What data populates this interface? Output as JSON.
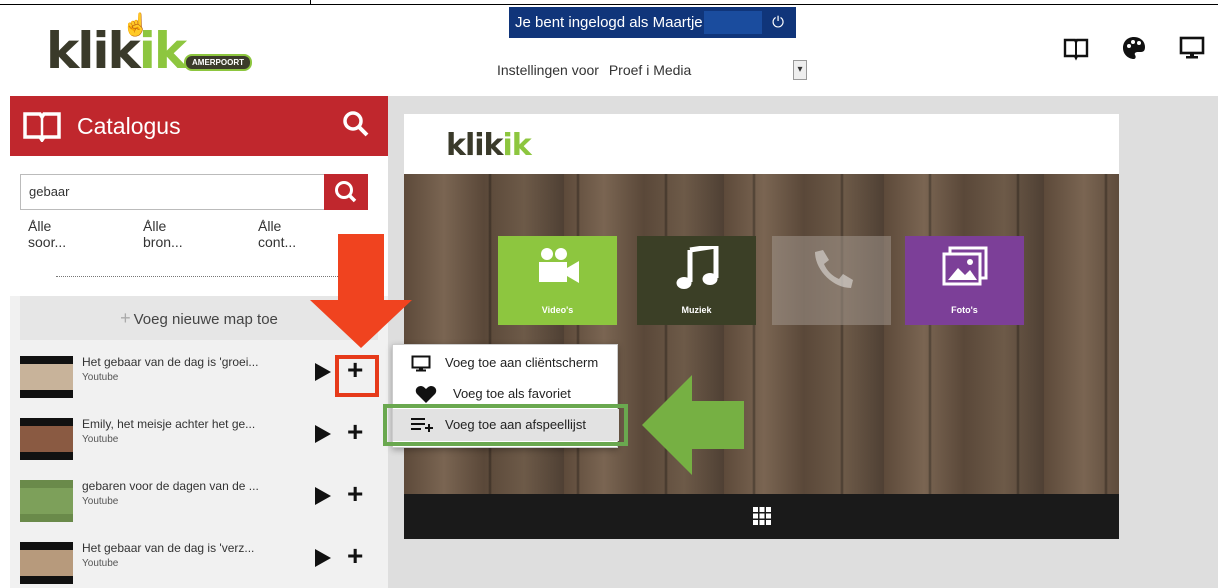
{
  "header": {
    "logo": {
      "main": "klik",
      "accent": "ik",
      "badge": "AMERPOORT"
    },
    "login_text": "Je bent ingelogd als Maartje",
    "settings_label": "Instellingen voor",
    "settings_value": "Proef i Media",
    "icons": [
      "book-icon",
      "palette-icon",
      "monitor-icon"
    ]
  },
  "catalog": {
    "title": "Catalogus",
    "search_value": "gebaar",
    "filters": [
      "Alle soor...",
      "Alle bron...",
      "Alle cont..."
    ],
    "new_folder": "Voeg nieuwe map toe",
    "items": [
      {
        "title": "Het gebaar van de dag is 'groei...",
        "source": "Youtube"
      },
      {
        "title": "Emily, het meisje achter het ge...",
        "source": "Youtube"
      },
      {
        "title": "gebaren voor de dagen van de ...",
        "source": "Youtube"
      },
      {
        "title": "Het gebaar van de dag is 'verz...",
        "source": "Youtube"
      }
    ]
  },
  "preview": {
    "logo": {
      "main": "klik",
      "accent": "ik"
    },
    "tiles": [
      {
        "label": "Video's",
        "color": "#8dc63f"
      },
      {
        "label": "Muziek",
        "color": "#3b3f26"
      },
      {
        "label": "Bellen",
        "color": "#9a8d80"
      },
      {
        "label": "Foto's",
        "color": "#7c3f98"
      }
    ]
  },
  "context_menu": {
    "items": [
      {
        "label": "Voeg toe aan cliëntscherm",
        "icon": "monitor-icon"
      },
      {
        "label": "Voeg toe als favoriet",
        "icon": "heart-icon"
      },
      {
        "label": "Voeg toe aan afspeellijst",
        "icon": "playlist-add-icon"
      }
    ]
  },
  "colors": {
    "brand_red": "#c0272d",
    "brand_green": "#8dc63f",
    "login_blue": "#10357a",
    "highlight_red": "#e63a1a",
    "highlight_green": "#6aa84f"
  }
}
